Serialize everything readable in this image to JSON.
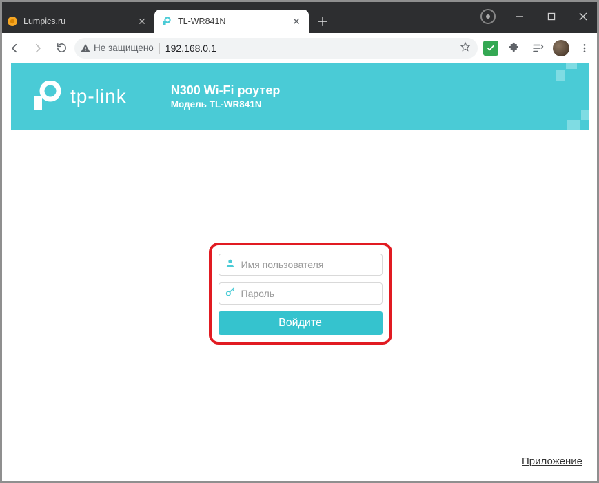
{
  "window": {
    "tabs": [
      {
        "title": "Lumpics.ru",
        "active": false,
        "favicon": "orange-circle"
      },
      {
        "title": "TL-WR841N",
        "active": true,
        "favicon": "tplink"
      }
    ]
  },
  "omnibox": {
    "security_label": "Не защищено",
    "url": "192.168.0.1"
  },
  "hero": {
    "brand": "tp-link",
    "title": "N300 Wi-Fi роутер",
    "subtitle": "Модель TL-WR841N"
  },
  "login": {
    "username_placeholder": "Имя пользователя",
    "password_placeholder": "Пароль",
    "username_value": "",
    "password_value": "",
    "submit_label": "Войдите"
  },
  "footer": {
    "app_link": "Приложение"
  },
  "colors": {
    "accent": "#4acbd6",
    "highlight_border": "#e11b22"
  }
}
